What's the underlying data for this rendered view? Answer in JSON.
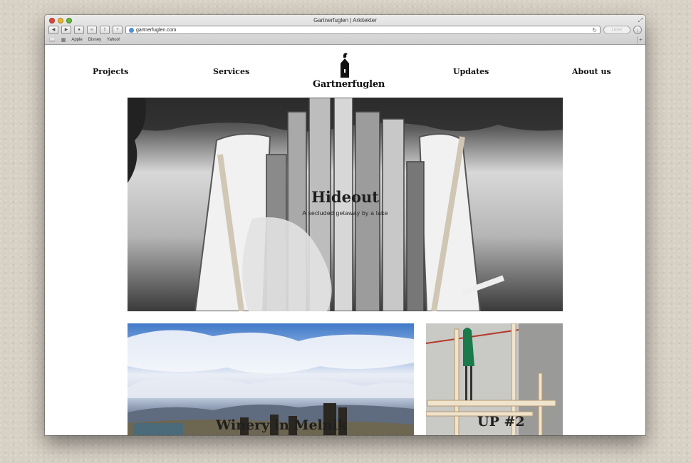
{
  "browser": {
    "window_title": "Gartnerfuglen | Arkitekter",
    "url": "gartnerfuglen.com",
    "reader_label": "Leser",
    "bookmarks": [
      "Apple",
      "Disney",
      "Yahoo!"
    ],
    "icons": {
      "back": "chevron-left-icon",
      "forward": "chevron-right-icon",
      "share": "share-icon",
      "add": "plus-icon",
      "reload": "reload-icon",
      "download": "download-icon"
    }
  },
  "site": {
    "logo_text": "Gartnerfuglen",
    "nav": [
      "Projects",
      "Services",
      "Updates",
      "About us"
    ]
  },
  "hero": {
    "title": "Hideout",
    "subtitle": "A secluded getaway by a lake"
  },
  "projects": [
    {
      "title": "Winery in Melnik"
    },
    {
      "title": "UP #2"
    }
  ]
}
